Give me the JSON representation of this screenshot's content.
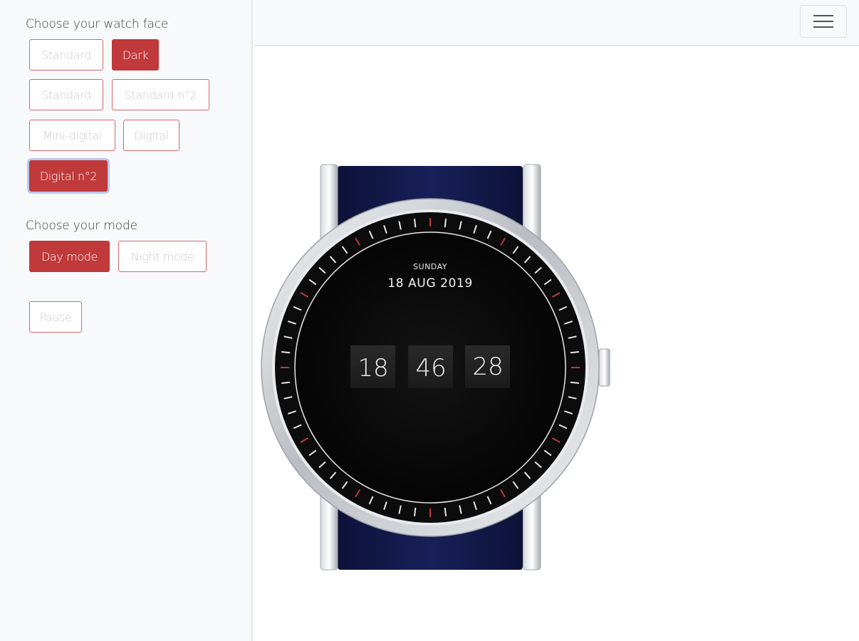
{
  "sidebar": {
    "face_title": "Choose your watch face",
    "faces": [
      {
        "label": "Standard",
        "active": false
      },
      {
        "label": "Dark",
        "active": true
      },
      {
        "label": "Standard",
        "active": false
      },
      {
        "label": "Standard n°2",
        "active": false
      },
      {
        "label": "Mini-digital",
        "active": false
      },
      {
        "label": "Digital",
        "active": false
      },
      {
        "label": "Digital n°2",
        "active": true
      }
    ],
    "mode_title": "Choose your mode",
    "modes": [
      {
        "label": "Day mode",
        "active": true
      },
      {
        "label": "Night mode",
        "active": false
      }
    ],
    "pause_label": "Pause"
  },
  "topbar": {
    "menu_icon": "hamburger-icon"
  },
  "watch": {
    "day": "SUNDAY",
    "date": "18 AUG 2019",
    "hours": "18",
    "minutes": "46",
    "seconds": "28",
    "colors": {
      "strap": "#141a4a",
      "dial": "#0a0a0a",
      "accent": "#c0393b",
      "case": "#d9dbe0"
    }
  }
}
